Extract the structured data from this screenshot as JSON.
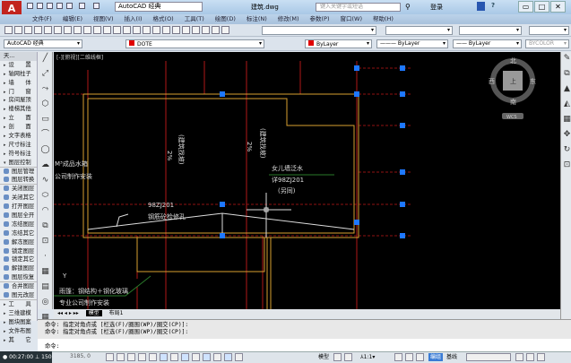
{
  "titlebar": {
    "workspace": "AutoCAD 经典",
    "document": "建筑.dwg",
    "search_placeholder": "键入关键字或短语",
    "login": "登录",
    "help": "?"
  },
  "menu": [
    "文件(F)",
    "编辑(E)",
    "视图(V)",
    "插入(I)",
    "格式(O)",
    "工具(T)",
    "绘图(D)",
    "标注(N)",
    "修改(M)",
    "参数(P)",
    "窗口(W)",
    "帮助(H)"
  ],
  "toolbar2": {
    "workspace": "AutoCAD 经典",
    "layer": "DOTE",
    "color": "ByLayer",
    "linetype": "ByLayer",
    "lineweight": "ByLayer",
    "plotstyle": "BYCOLOR"
  },
  "colors": {
    "accent": "#c2241e",
    "layer_red": "#e00000",
    "grip": "#1e78ff",
    "orange": "#d8a030",
    "dashed": "#c01818"
  },
  "viewport_label": "[-][俯视][二维线框]",
  "sidebar": {
    "header": "天...",
    "items": [
      {
        "label": "设　　置",
        "type": "arrow"
      },
      {
        "label": "轴网柱子",
        "type": "arrow"
      },
      {
        "label": "墙　　体",
        "type": "arrow"
      },
      {
        "label": "门　　窗",
        "type": "arrow"
      },
      {
        "label": "房间屋顶",
        "type": "arrow"
      },
      {
        "label": "楼梯其他",
        "type": "arrow"
      },
      {
        "label": "立　　面",
        "type": "arrow"
      },
      {
        "label": "剖　　面",
        "type": "arrow"
      },
      {
        "label": "文字表格",
        "type": "arrow"
      },
      {
        "label": "尺寸标注",
        "type": "arrow"
      },
      {
        "label": "符号标注",
        "type": "arrow"
      },
      {
        "label": "图层控制",
        "type": "open"
      },
      {
        "label": "图层管理",
        "type": "icon"
      },
      {
        "label": "图层转换",
        "type": "icon"
      },
      {
        "label": "关闭图层",
        "type": "icon"
      },
      {
        "label": "关闭其它",
        "type": "icon"
      },
      {
        "label": "打开图层",
        "type": "icon"
      },
      {
        "label": "图层全开",
        "type": "icon"
      },
      {
        "label": "冻结图层",
        "type": "icon"
      },
      {
        "label": "冻结其它",
        "type": "icon"
      },
      {
        "label": "解冻图层",
        "type": "icon"
      },
      {
        "label": "锁定图层",
        "type": "icon"
      },
      {
        "label": "锁定其它",
        "type": "icon"
      },
      {
        "label": "解锁图层",
        "type": "icon"
      },
      {
        "label": "图层恢复",
        "type": "icon"
      },
      {
        "label": "合并图层",
        "type": "icon"
      },
      {
        "label": "图元改层",
        "type": "icon"
      },
      {
        "label": "工　　具",
        "type": "arrow"
      },
      {
        "label": "三维建模",
        "type": "arrow"
      },
      {
        "label": "图块图案",
        "type": "arrow"
      },
      {
        "label": "文件布图",
        "type": "arrow"
      },
      {
        "label": "其　　它",
        "type": "arrow"
      }
    ]
  },
  "drawing": {
    "slope1": "2%",
    "slope1_note": "(建筑找坡)",
    "slope2": "2%",
    "slope2_note": "(建筑找坡)",
    "tank1": "M³成品水箱",
    "tank2": "公司制作安装",
    "parapet1": "女儿墙泛水",
    "parapet2": "详98ZJ201",
    "parapet3": "(另同)",
    "hole1": "98ZJ201",
    "hole2": "钢筋砼检修孔",
    "canopy1": "雨篷：钢结构＋钢化玻璃",
    "canopy2": "专业公司制作安装",
    "ucs_y": "Y"
  },
  "viewcube": {
    "north": "北",
    "south": "南",
    "east": "东",
    "west": "西",
    "top": "上",
    "wcs": "WCS"
  },
  "tabs": [
    "模型",
    "布局1"
  ],
  "command": {
    "history": [
      "命令: 指定对角点或 [栏选(F)/圈围(WP)/圈交(CP)]:",
      "命令: 指定对角点或 [栏选(F)/圈围(WP)/圈交(CP)]:"
    ],
    "prompt": "命令:"
  },
  "status": {
    "timer": "00:27:00",
    "scale_count": "150",
    "coords": "3185, 0",
    "model": "模型",
    "annoscale": "1:1",
    "mode": "编组",
    "base": "基线"
  }
}
